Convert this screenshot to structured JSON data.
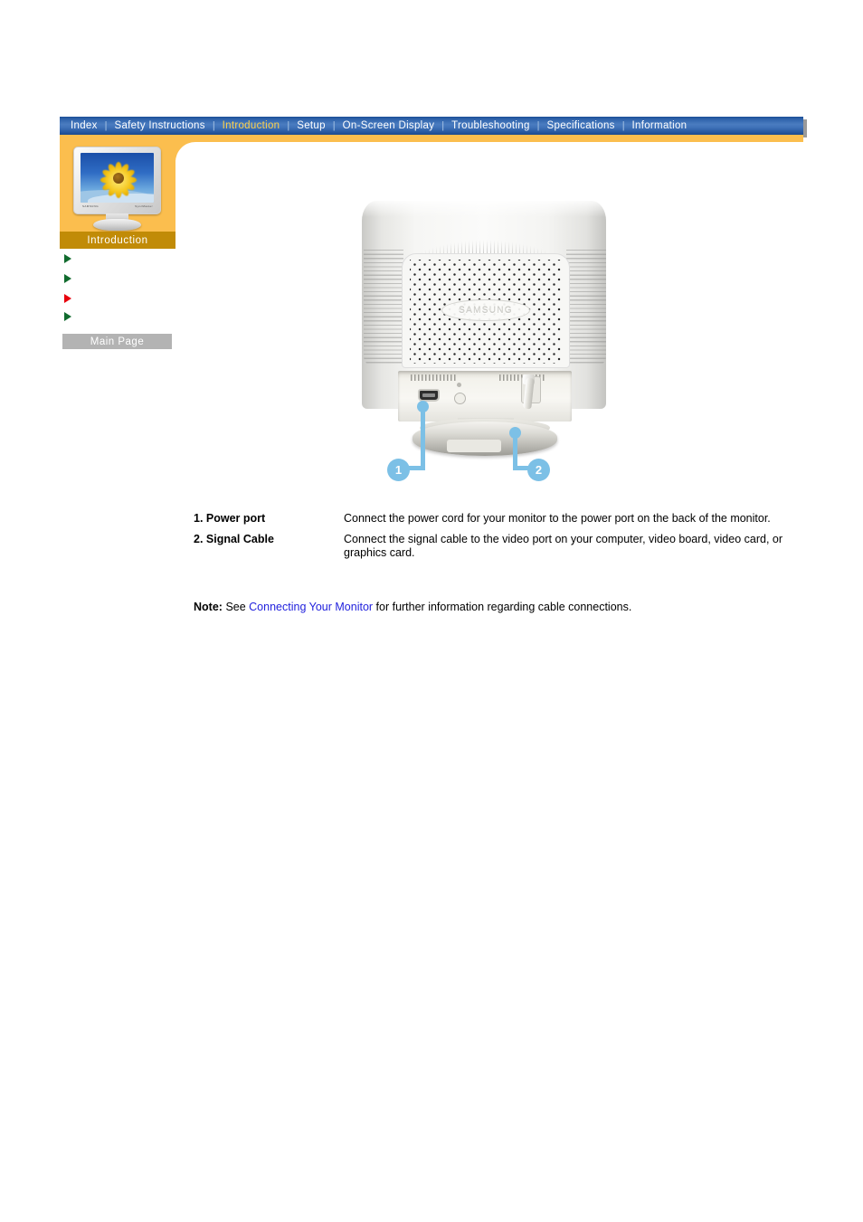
{
  "nav": {
    "items": [
      {
        "label": "Index",
        "active": false
      },
      {
        "label": "Safety Instructions",
        "active": false
      },
      {
        "label": "Introduction",
        "active": true
      },
      {
        "label": "Setup",
        "active": false
      },
      {
        "label": "On-Screen Display",
        "active": false
      },
      {
        "label": "Troubleshooting",
        "active": false
      },
      {
        "label": "Specifications",
        "active": false
      },
      {
        "label": "Information",
        "active": false
      }
    ],
    "separator": "|",
    "active_color": "#ffd24a",
    "bar_color": "#2f63ab",
    "text_color": "#ffffff"
  },
  "sidebar": {
    "section_label": "Introduction",
    "section_label_bg": "#c18b07",
    "accent_color": "#fbbe4e",
    "thumbnail": {
      "brand_left": "SAMSUNG",
      "brand_right": "SyncMaster",
      "alt": "monitor-thumbnail-sunflower"
    },
    "bullets": [
      {
        "name": "bullet-1",
        "color": "#116b2e"
      },
      {
        "name": "bullet-2",
        "color": "#116b2e"
      },
      {
        "name": "bullet-3",
        "color": "#e8000c"
      },
      {
        "name": "bullet-4",
        "color": "#116b2e"
      }
    ],
    "main_page_button": "Main Page",
    "main_page_bg": "#b3b3b3"
  },
  "figure": {
    "alt": "rear-view-of-monitor",
    "brand_emboss": "SAMSUNG",
    "callouts": [
      {
        "number": "1",
        "target": "power-port",
        "color": "#7cc0e6"
      },
      {
        "number": "2",
        "target": "signal-cable",
        "color": "#7cc0e6"
      }
    ]
  },
  "content": {
    "rows": [
      {
        "label": "1. Power port",
        "description": "Connect the power cord for your monitor to the power port on the back of the monitor."
      },
      {
        "label": "2. Signal Cable",
        "description": "Connect the signal cable to the video port on your computer, video board, video card, or graphics card."
      }
    ],
    "note": {
      "label": "Note:",
      "before_link": "See ",
      "link_text": "Connecting Your Monitor",
      "after_link": " for further information regarding cable connections.",
      "link_color": "#2222dd"
    }
  }
}
